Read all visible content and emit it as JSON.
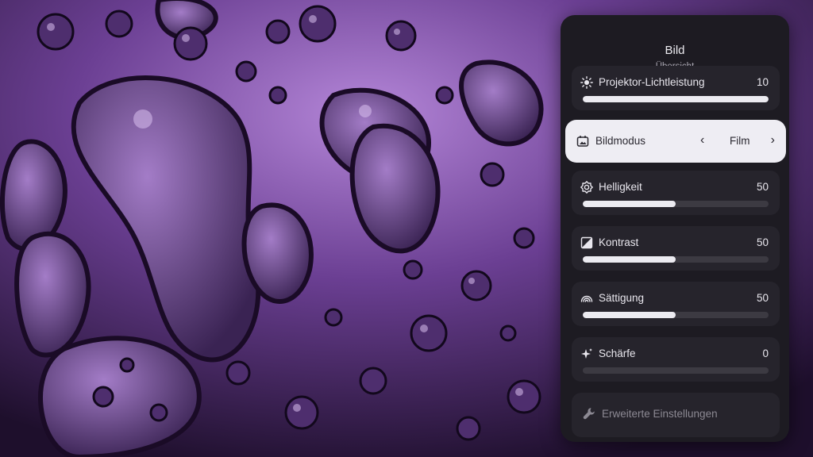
{
  "panel": {
    "title": "Bild",
    "subtitle": "Übersicht"
  },
  "items": [
    {
      "label": "Projektor-Lichtleistung",
      "value": "10",
      "level": 100,
      "icon": "sun-icon"
    },
    {
      "label": "Bildmodus",
      "value": "Film",
      "icon": "picture-mode-icon",
      "selected": true
    },
    {
      "label": "Helligkeit",
      "value": "50",
      "level": 50,
      "icon": "brightness-icon"
    },
    {
      "label": "Kontrast",
      "value": "50",
      "level": 50,
      "icon": "contrast-icon"
    },
    {
      "label": "Sättigung",
      "value": "50",
      "level": 50,
      "icon": "saturation-icon"
    },
    {
      "label": "Schärfe",
      "value": "0",
      "level": 0,
      "icon": "sparkle-icon"
    }
  ],
  "advanced": {
    "label": "Erweiterte Einstellungen",
    "icon": "wrench-icon"
  },
  "colors": {
    "panel": "#1d1b22",
    "card": "#26242c",
    "selected_card": "#eeedf3",
    "slider_fill": "#ecebf1",
    "slider_track": "#3c3a42",
    "background_purple": "#8a5cb8"
  }
}
